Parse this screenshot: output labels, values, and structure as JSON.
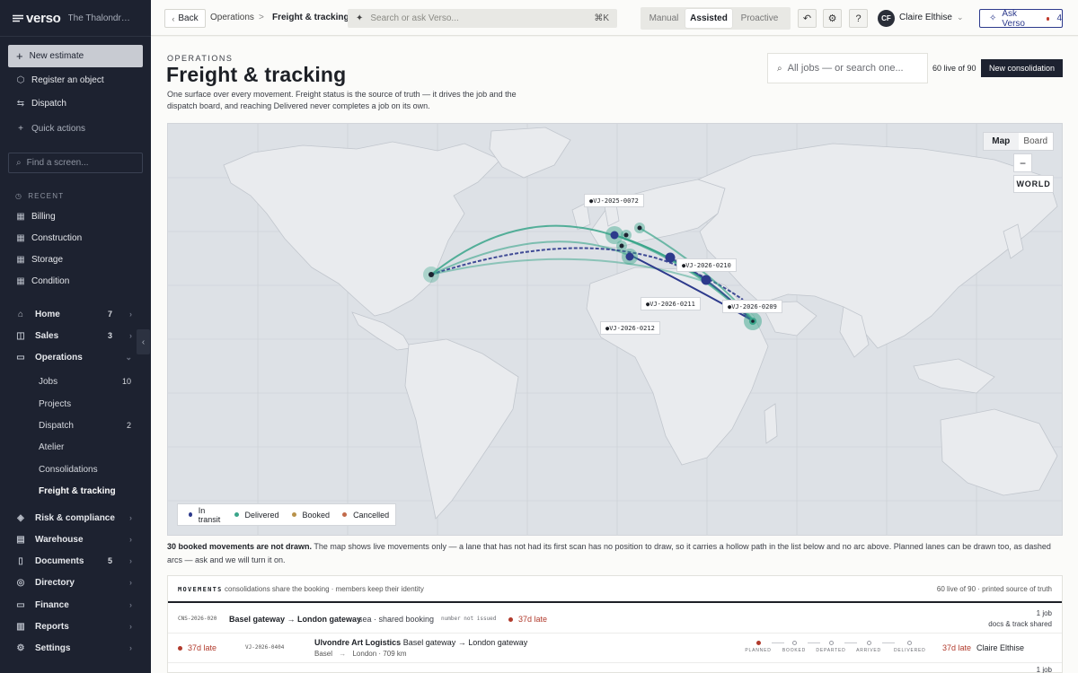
{
  "brand": {
    "logo": "verso",
    "org": "The Thalondre Archive"
  },
  "sidebar": {
    "new_estimate": "New estimate",
    "actions": [
      {
        "label": "Register an object",
        "icon": "cube-icon"
      },
      {
        "label": "Dispatch",
        "icon": "truck-icon"
      }
    ],
    "quick_actions": "Quick actions",
    "search_placeholder": "Find a screen...",
    "recent_label": "RECENT",
    "recent": [
      "Billing",
      "Construction",
      "Storage",
      "Condition"
    ],
    "nav": [
      {
        "label": "Home",
        "count": "7"
      },
      {
        "label": "Sales",
        "count": "3"
      },
      {
        "label": "Operations",
        "count": ""
      }
    ],
    "operations_sub": [
      {
        "label": "Jobs",
        "count": "10"
      },
      {
        "label": "Projects",
        "count": ""
      },
      {
        "label": "Dispatch",
        "count": "2"
      },
      {
        "label": "Atelier",
        "count": ""
      },
      {
        "label": "Consolidations",
        "count": ""
      },
      {
        "label": "Freight & tracking",
        "count": ""
      }
    ],
    "nav_lower": [
      {
        "label": "Risk & compliance",
        "count": ""
      },
      {
        "label": "Warehouse",
        "count": ""
      },
      {
        "label": "Documents",
        "count": "5"
      },
      {
        "label": "Directory",
        "count": ""
      },
      {
        "label": "Finance",
        "count": ""
      },
      {
        "label": "Reports",
        "count": ""
      },
      {
        "label": "Settings",
        "count": ""
      }
    ]
  },
  "topbar": {
    "back": "Back",
    "crumb_parent": "Operations",
    "crumb_sep": ">",
    "crumb_current": "Freight & tracking",
    "search_placeholder": "Search or ask Verso...",
    "search_kbd": "⌘K",
    "modes": [
      "Manual",
      "Assisted",
      "Proactive"
    ],
    "active_mode": "Assisted",
    "user_initials": "CF",
    "user_name": "Claire Elthise",
    "ask_label": "Ask Verso",
    "ask_count": "4"
  },
  "page": {
    "eyebrow": "OPERATIONS",
    "title": "Freight & tracking",
    "description": "One surface over every movement. Freight status is the source of truth — it drives the job and the dispatch board, and reaching Delivered never completes a job on its own.",
    "jobs_search_placeholder": "All jobs — or search one...",
    "live_count": "60 live of 90",
    "new_consolidation": "New consolidation"
  },
  "map": {
    "toggle": [
      "Map",
      "Board"
    ],
    "active_view": "Map",
    "zoom_out": "−",
    "world": "WORLD",
    "labels": [
      "●VJ-2025-0072",
      "●VJ-2026-0210",
      "●VJ-2026-0211",
      "●VJ-2026-0209",
      "●VJ-2026-0212"
    ],
    "legend": [
      {
        "label": "In transit",
        "color": "#2d3a8c"
      },
      {
        "label": "Delivered",
        "color": "#3aa58a"
      },
      {
        "label": "Booked",
        "color": "#b9924a"
      },
      {
        "label": "Cancelled",
        "color": "#c26a4a"
      }
    ]
  },
  "note": {
    "bold": "30 booked movements are not drawn.",
    "text": " The map shows live movements only — a lane that has not had its first scan has no position to draw, so it carries a hollow path in the list below and no arc above. Planned lanes can be drawn too, as dashed arcs — ask and we will turn it on."
  },
  "movements": {
    "title": "MOVEMENTS",
    "subtitle": "consolidations share the booking · members keep their identity",
    "right": "60 live of 90 · printed source of truth",
    "consolidation": {
      "id": "CNS-2026-020",
      "route": "Basel gateway → London gateway",
      "mode": "sea · shared booking",
      "number": "number not issued",
      "late": "37d late",
      "jobs": "1 job",
      "docs": "docs & track shared"
    },
    "row": {
      "late": "37d late",
      "id": "VJ-2026-0404",
      "carrier": "Ulvondre Art Logistics",
      "route": "Basel gateway → London gateway",
      "origin": "Basel",
      "dest": "London · 709 km",
      "stages": [
        "PLANNED",
        "BOOKED",
        "DEPARTED",
        "ARRIVED",
        "DELIVERED"
      ],
      "late_right": "37d late",
      "owner": "Claire Elthise"
    },
    "next_jobs": "1 job"
  }
}
